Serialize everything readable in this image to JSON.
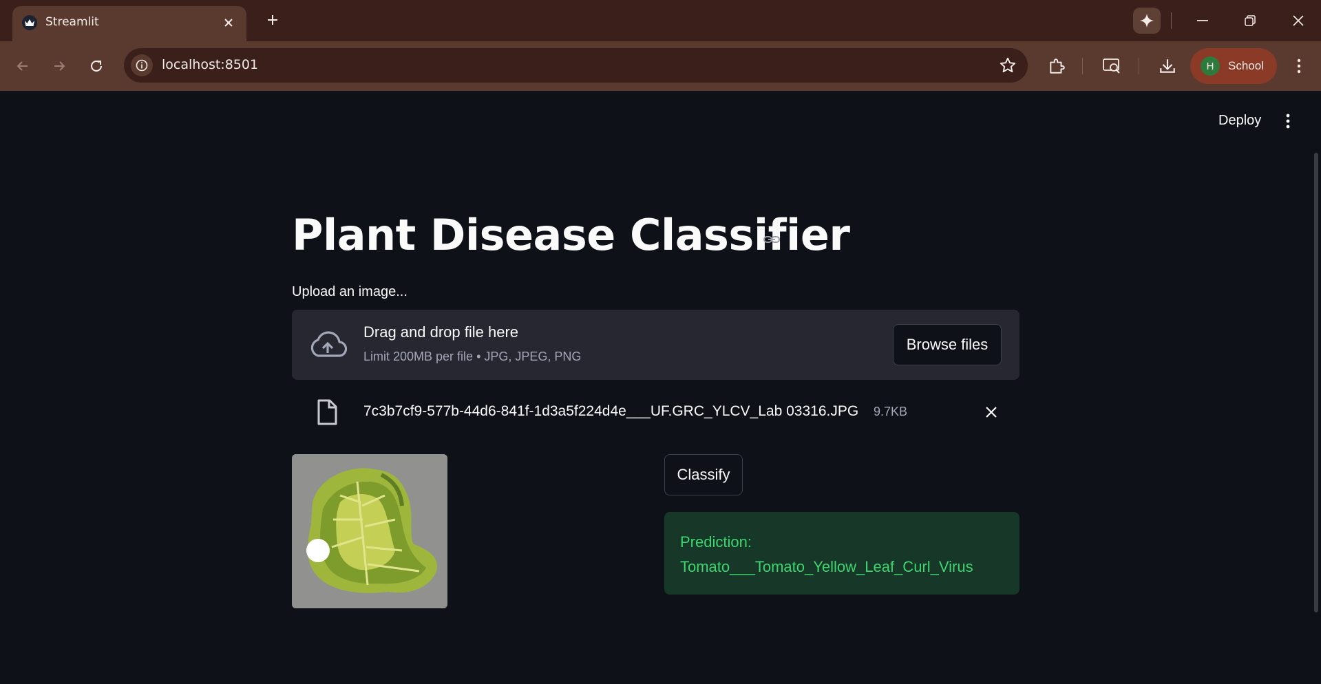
{
  "browser": {
    "tab_title": "Streamlit",
    "url": "localhost:8501",
    "profile_initial": "H",
    "profile_name": "School"
  },
  "app": {
    "deploy_label": "Deploy",
    "title": "Plant Disease Classifier",
    "upload_label": "Upload an image...",
    "dropzone": {
      "title": "Drag and drop file here",
      "subtitle": "Limit 200MB per file • JPG, JPEG, PNG",
      "browse_label": "Browse files"
    },
    "file": {
      "name": "7c3b7cf9-577b-44d6-841f-1d3a5f224d4e___UF.GRC_YLCV_Lab 03316.JPG",
      "size": "9.7KB"
    },
    "classify_label": "Classify",
    "prediction": {
      "label": "Prediction:",
      "value": "Tomato___Tomato_Yellow_Leaf_Curl_Virus"
    }
  },
  "colors": {
    "app_bg": "#0e1117",
    "chrome_tab_bar": "#3a1f1a",
    "chrome_toolbar": "#5a3a2f",
    "dropzone_bg": "#262730",
    "success_bg": "#173828",
    "success_text": "#3dd56d",
    "profile_bg": "#8a3a26"
  },
  "icons": [
    "streamlit-crown-icon",
    "close-icon",
    "plus-icon",
    "gemini-sparkle-icon",
    "minimize-icon",
    "restore-icon",
    "back-icon",
    "forward-icon",
    "reload-icon",
    "site-info-icon",
    "star-icon",
    "extensions-icon",
    "google-lens-icon",
    "download-icon",
    "more-vert-icon",
    "link-icon",
    "cloud-upload-icon",
    "file-icon"
  ]
}
